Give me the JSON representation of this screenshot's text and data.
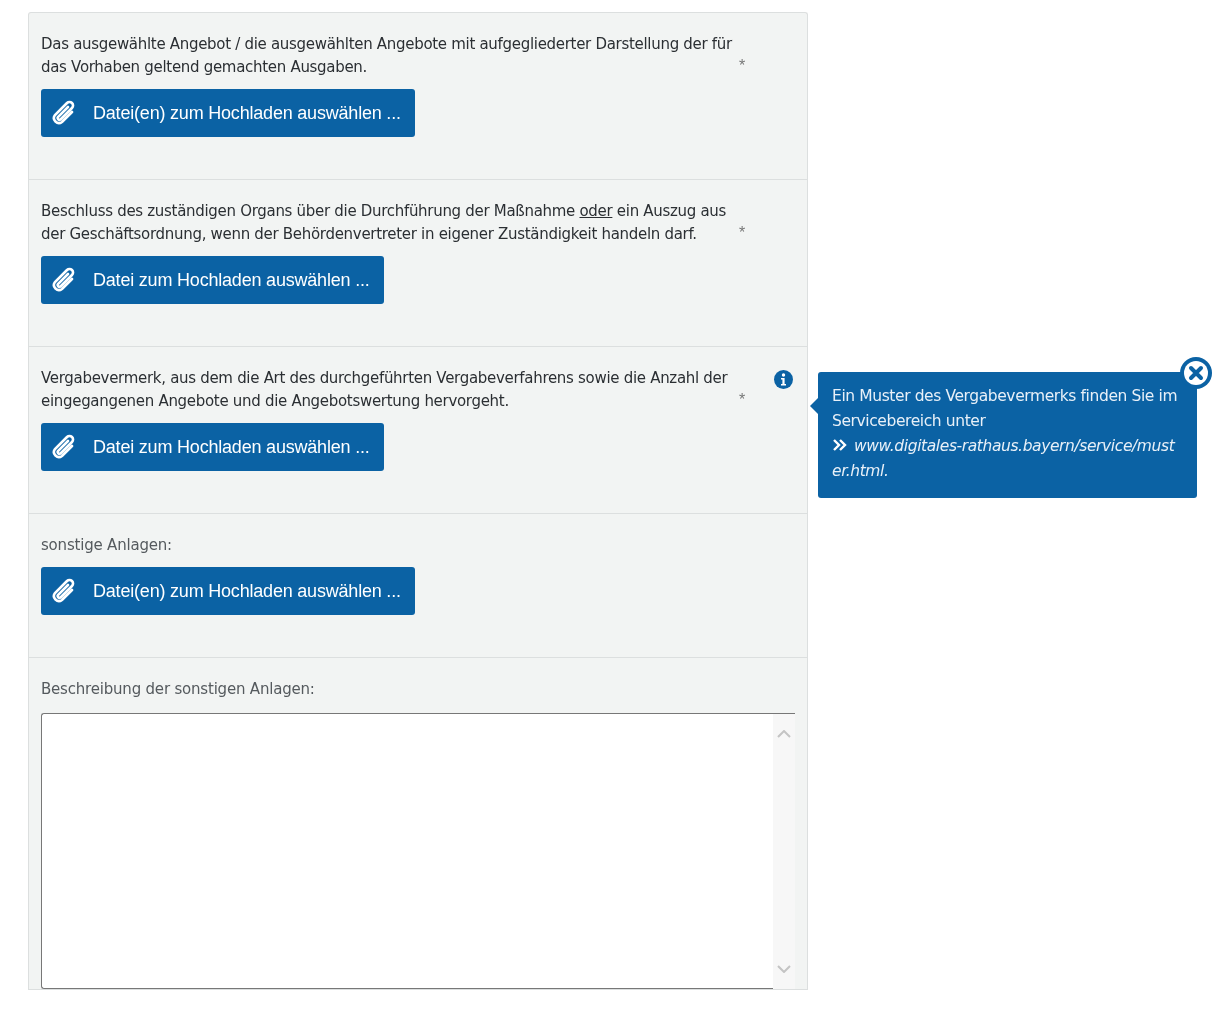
{
  "sections": [
    {
      "kind": "upload",
      "strong": true,
      "label": [
        {
          "text": "Das ausgewählte Angebot / die ausgewählten Angebote mit aufgegliederter Darstellung der für das Vorhaben geltend gemachten Ausgaben.",
          "underline": false
        }
      ],
      "required_mark": "*",
      "button": "Datei(en) zum Hochladen auswählen ..."
    },
    {
      "kind": "upload",
      "strong": true,
      "label": [
        {
          "text": "Beschluss des zuständigen Organs über die Durchführung der Maßnahme ",
          "underline": false
        },
        {
          "text": "oder",
          "underline": true
        },
        {
          "text": " ein Auszug aus der Geschäftsordnung, wenn der Behördenvertreter in eigener Zuständigkeit handeln darf.",
          "underline": false
        }
      ],
      "required_mark": "*",
      "button": "Datei zum Hochladen auswählen ..."
    },
    {
      "kind": "upload",
      "strong": true,
      "info": true,
      "label": [
        {
          "text": "Vergabevermerk, aus dem die Art des durchgeführten Vergabeverfahrens sowie die Anzahl der eingegangenen Angebote und die Angebotswertung hervorgeht.",
          "underline": false
        }
      ],
      "required_mark": "*",
      "button": "Datei zum Hochladen auswählen ..."
    },
    {
      "kind": "upload",
      "strong": false,
      "label": [
        {
          "text": "sonstige Anlagen:",
          "underline": false
        }
      ],
      "button": "Datei(en) zum Hochladen auswählen ..."
    },
    {
      "kind": "textarea",
      "strong": false,
      "label": [
        {
          "text": "Beschreibung der sonstigen Anlagen:",
          "underline": false
        }
      ]
    }
  ],
  "tooltip": {
    "text": "Ein Muster des Vergabevermerks finden Sie im Servicebereich unter",
    "link": "www.digitales-rathaus.bayern/service/muster.html."
  }
}
